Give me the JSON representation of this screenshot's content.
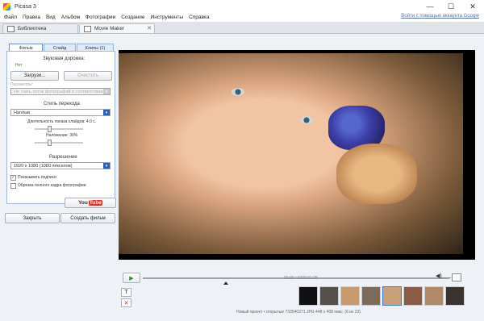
{
  "window": {
    "title": "Picasa 3",
    "minimize": "—",
    "maximize": "☐",
    "close": "✕"
  },
  "menu": [
    "Файл",
    "Правка",
    "Вид",
    "Альбом",
    "Фотографии",
    "Создание",
    "Инструменты",
    "Справка"
  ],
  "signin_link": "Войти с помощью аккаунта Google",
  "tabs": [
    {
      "label": "Библиотека"
    },
    {
      "label": "Movie Maker",
      "close": "✕"
    }
  ],
  "panel": {
    "tabs": [
      "Фильм",
      "Слайд",
      "Клипы (1)"
    ],
    "audio_label": "Звуковая дорожка:",
    "no_audio": "Нет",
    "load_button": "Загрузи...",
    "clear_button": "Очистить",
    "options_label": "Параметры:",
    "options_value": "Не гнать поток фотографий в соответствии...",
    "transition_label": "Стиль перехода",
    "transition_value": "Наплыв",
    "duration_label": "Длительность показа слайдов: 4.0 с.",
    "overlap_label": "Наложение: 30%",
    "duration_value": 0.3,
    "overlap_value": 0.3,
    "resolution_label": "Разрешение",
    "resolution_value": "1920 x 1080 (1080 пикселов)",
    "show_captions": "Показывать подписи",
    "crop_full": "Обрезка полного кадра фотографии",
    "show_captions_checked": true,
    "crop_full_checked": false,
    "youtube_button": "You",
    "youtube_tube": "Tube",
    "close_button": "Закрыть",
    "create_button": "Создать фильм"
  },
  "player": {
    "time": "00:00 / 0000:01:28",
    "play_icon": "▶",
    "volume_icon": "◀)"
  },
  "side_icons": {
    "text": "T",
    "delete": "✕"
  },
  "status": "Новый проект • открытые 733540271.JPG   448 x 408 пикс.   (6 из 23)",
  "colors": {
    "accent": "#2d5fb0",
    "bg": "#eef1f5"
  }
}
